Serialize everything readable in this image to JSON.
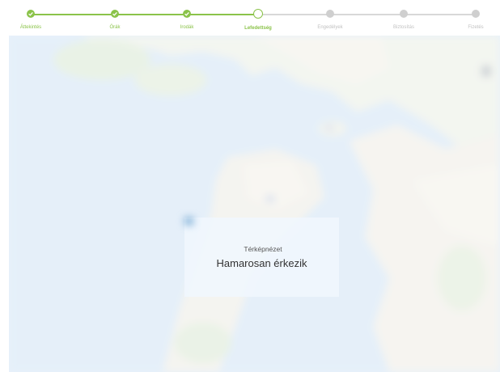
{
  "stepper": {
    "steps": [
      {
        "label": "Áttekintés",
        "state": "done"
      },
      {
        "label": "Órák",
        "state": "done"
      },
      {
        "label": "Irodák",
        "state": "done"
      },
      {
        "label": "Lefedettség",
        "state": "current"
      },
      {
        "label": "Engedélyek",
        "state": "pending"
      },
      {
        "label": "Biztosítás",
        "state": "pending"
      },
      {
        "label": "Fizetés",
        "state": "pending"
      }
    ],
    "colors": {
      "done": "#8bc34a",
      "pending": "#cfcfcf"
    }
  },
  "map": {
    "overlay": {
      "icon": "map-icon",
      "title": "Térképnézet",
      "message": "Hamarosan érkezik"
    }
  }
}
